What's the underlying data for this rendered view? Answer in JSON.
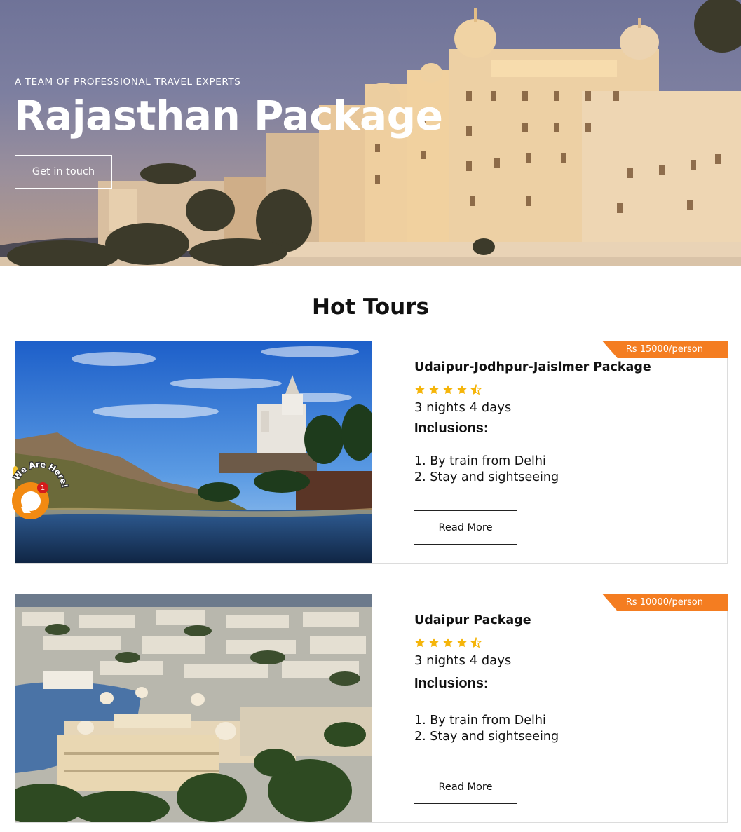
{
  "hero": {
    "eyebrow": "A TEAM OF PROFESSIONAL TRAVEL EXPERTS",
    "title": "Rajasthan Package",
    "cta_label": "Get in touch"
  },
  "section": {
    "title": "Hot Tours"
  },
  "tours": [
    {
      "price": "Rs 15000/person",
      "title": "Udaipur-Jodhpur-Jaislmer Package",
      "rating": 4.5,
      "duration": "3 nights 4 days",
      "inclusions_title": "Inclusions:",
      "inclusions": [
        "1. By train from Delhi",
        "2. Stay and sightseeing"
      ],
      "button_label": "Read More"
    },
    {
      "price": "Rs 10000/person",
      "title": "Udaipur Package",
      "rating": 4.5,
      "duration": "3 nights 4 days",
      "inclusions_title": "Inclusions:",
      "inclusions": [
        "1. By train from Delhi",
        "2. Stay and sightseeing"
      ],
      "button_label": "Read More"
    }
  ],
  "chat": {
    "label": "We Are Here!",
    "badge_count": "1"
  },
  "colors": {
    "accent": "#f47d21",
    "star": "#f5b50a",
    "chat": "#f28a12",
    "badge": "#d51b1b"
  },
  "icons": [
    "star-icon",
    "half-star-icon",
    "chat-icon"
  ]
}
